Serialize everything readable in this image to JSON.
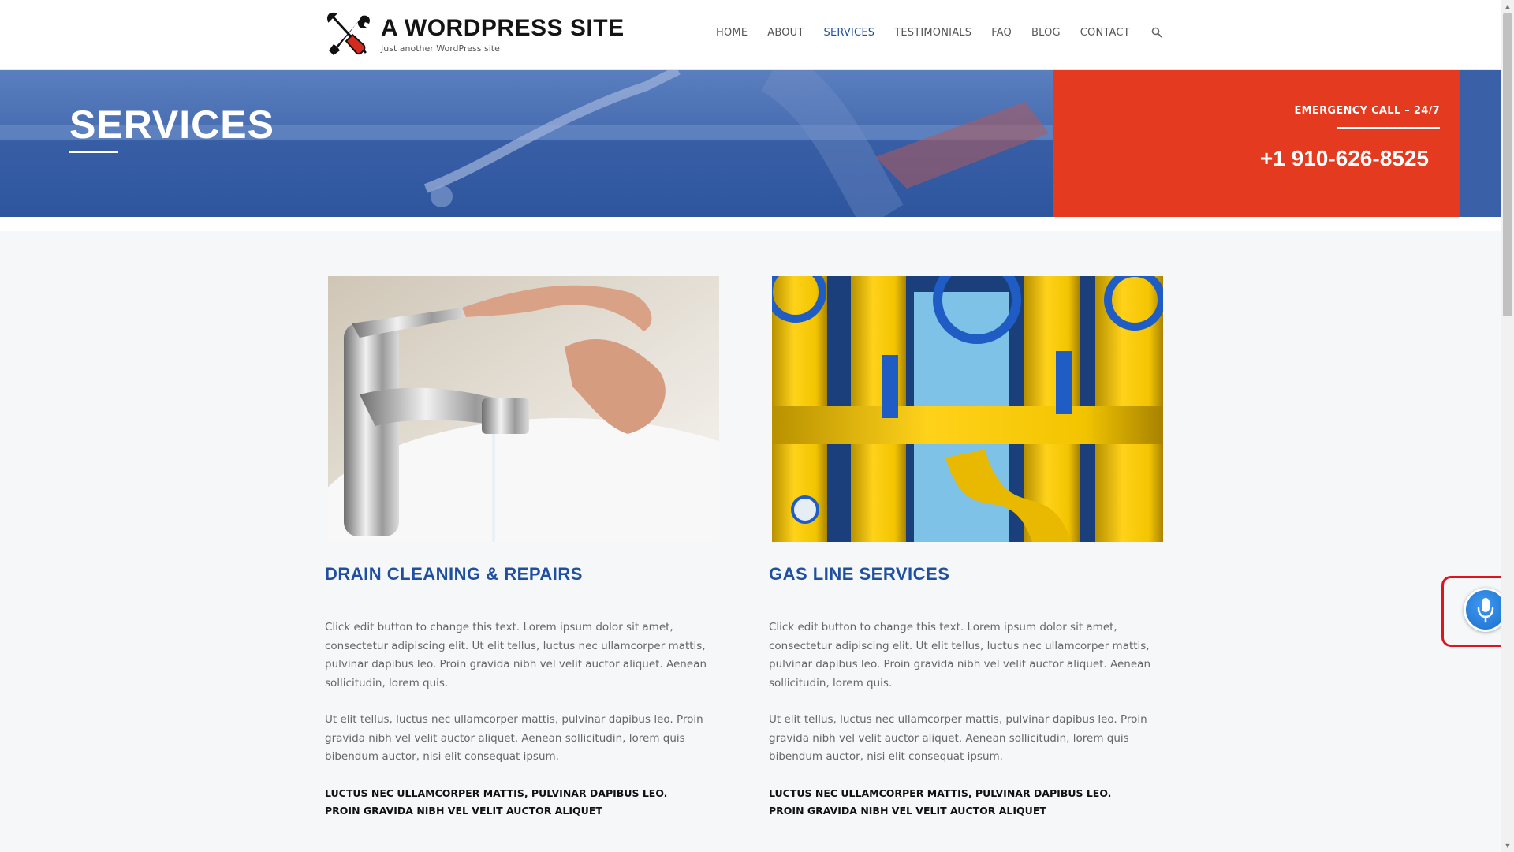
{
  "site": {
    "title": "A WORDPRESS SITE",
    "tagline": "Just another WordPress site"
  },
  "nav": {
    "items": [
      {
        "label": "HOME"
      },
      {
        "label": "ABOUT"
      },
      {
        "label": "SERVICES",
        "active": true
      },
      {
        "label": "TESTIMONIALS"
      },
      {
        "label": "FAQ"
      },
      {
        "label": "BLOG"
      },
      {
        "label": "CONTACT"
      }
    ],
    "search_icon": "search-icon"
  },
  "hero": {
    "title": "SERVICES",
    "emergency_label": "EMERGENCY CALL – 24/7",
    "phone": "+1 910-626-8525"
  },
  "services": [
    {
      "title": "DRAIN CLEANING & REPAIRS",
      "image": "faucet-photo",
      "p1": "Click edit button to change this text. Lorem ipsum dolor sit amet, consectetur adipiscing elit. Ut elit tellus, luctus nec ullamcorper mattis, pulvinar dapibus leo. Proin gravida nibh vel velit auctor aliquet. Aenean sollicitudin, lorem quis.",
      "p2": "Ut elit tellus, luctus nec ullamcorper mattis, pulvinar dapibus leo. Proin gravida nibh vel velit auctor aliquet. Aenean sollicitudin, lorem quis bibendum auctor, nisi elit consequat ipsum.",
      "bold": "LUCTUS NEC ULLAMCORPER MATTIS, PULVINAR DAPIBUS LEO. PROIN GRAVIDA NIBH VEL VELIT AUCTOR ALIQUET"
    },
    {
      "title": "GAS LINE SERVICES",
      "image": "gas-pipes-photo",
      "p1": "Click edit button to change this text. Lorem ipsum dolor sit amet, consectetur adipiscing elit. Ut elit tellus, luctus nec ullamcorper mattis, pulvinar dapibus leo. Proin gravida nibh vel velit auctor aliquet. Aenean sollicitudin, lorem quis.",
      "p2": "Ut elit tellus, luctus nec ullamcorper mattis, pulvinar dapibus leo. Proin gravida nibh vel velit auctor aliquet. Aenean sollicitudin, lorem quis bibendum auctor, nisi elit consequat ipsum.",
      "bold": "LUCTUS NEC ULLAMCORPER MATTIS, PULVINAR DAPIBUS LEO. PROIN GRAVIDA NIBH VEL VELIT AUCTOR ALIQUET"
    }
  ],
  "voice_button": {
    "icon": "microphone-icon"
  },
  "colors": {
    "accent_blue": "#1e4fa0",
    "emergency_red": "#e43a1f",
    "hero_blue": "#3d63a8",
    "highlight_red": "#e0141e"
  }
}
